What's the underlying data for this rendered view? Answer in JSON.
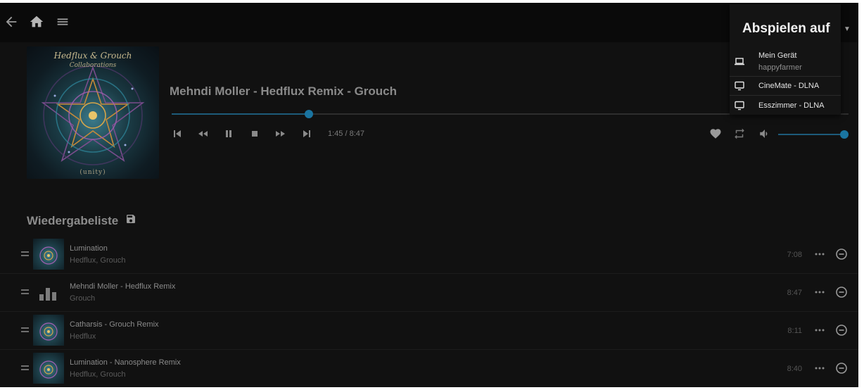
{
  "topbar": {
    "icons": [
      "back-arrow-icon",
      "home-icon",
      "menu-icon"
    ]
  },
  "album": {
    "cover_title": "Hedflux & Grouch",
    "cover_subtitle": "Collaborations",
    "cover_logo": "(unity)"
  },
  "now_playing": {
    "title": "Mehndi Moller - Hedflux Remix - Grouch",
    "time": "1:45 / 8:47",
    "progress": 0.203,
    "volume": 1.0,
    "controls": [
      "skip-previous-icon",
      "rewind-icon",
      "pause-icon",
      "stop-icon",
      "fast-forward-icon",
      "skip-next-icon"
    ],
    "right_controls": [
      "heart-icon",
      "repeat-icon",
      "volume-icon"
    ]
  },
  "playlist": {
    "heading": "Wiedergabeliste",
    "items": [
      {
        "title": "Lumination",
        "artist": "Hedflux, Grouch",
        "duration": "7:08",
        "playing": false
      },
      {
        "title": "Mehndi Moller - Hedflux Remix",
        "artist": "Grouch",
        "duration": "8:47",
        "playing": true
      },
      {
        "title": "Catharsis - Grouch Remix",
        "artist": "Hedflux",
        "duration": "8:11",
        "playing": false
      },
      {
        "title": "Lumination - Nanosphere Remix",
        "artist": "Hedflux, Grouch",
        "duration": "8:40",
        "playing": false
      }
    ]
  },
  "play_on": {
    "title": "Abspielen auf",
    "devices": [
      {
        "name": "Mein Gerät",
        "sub": "happyfarmer",
        "icon": "laptop-icon"
      },
      {
        "name": "CineMate - DLNA",
        "sub": "",
        "icon": "monitor-icon"
      },
      {
        "name": "Esszimmer - DLNA",
        "sub": "",
        "icon": "monitor-icon"
      }
    ]
  },
  "colors": {
    "accent": "#1a74a0",
    "background": "#111111",
    "popup": "#141414"
  }
}
